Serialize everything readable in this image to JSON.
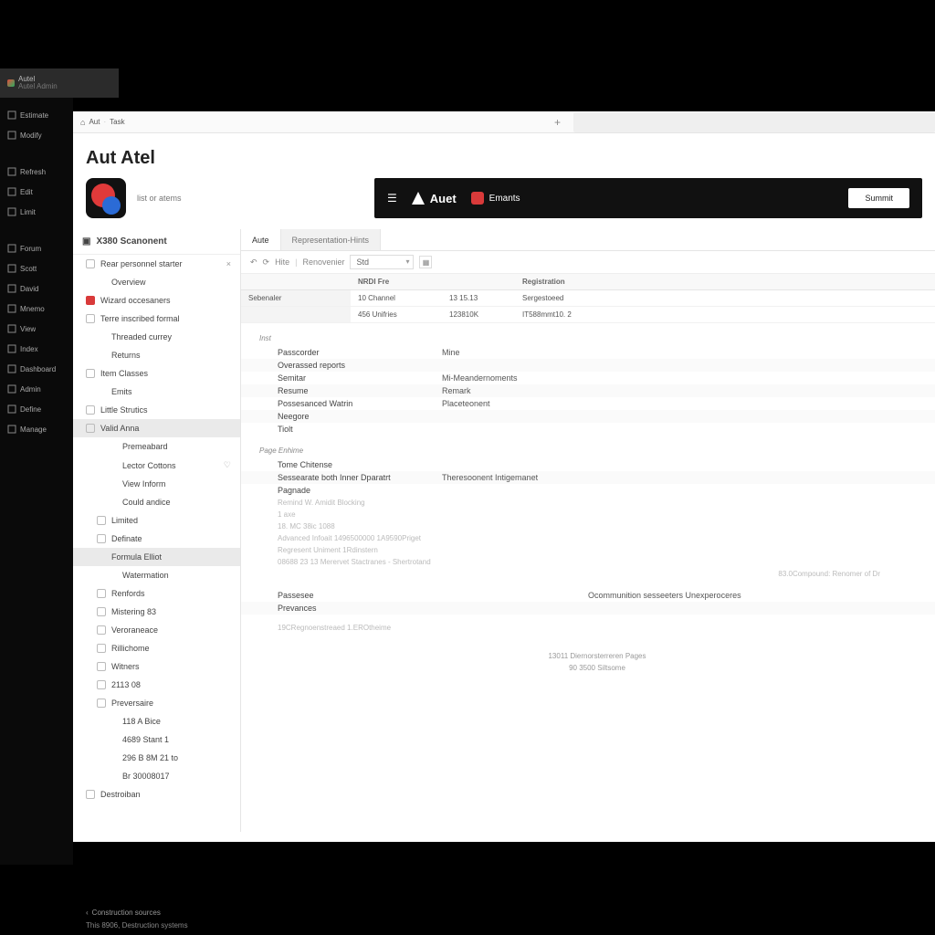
{
  "window_tab": {
    "title": "Autel",
    "subtitle": "Autel Admin"
  },
  "nav_rail": [
    "Estimate",
    "Modify",
    "",
    "Refresh",
    "Edit",
    "Limit",
    "",
    "Forum",
    "Scott",
    "David",
    "Mnemo",
    "View",
    "Index",
    "Dashboard",
    "Admin",
    "Define",
    "Manage"
  ],
  "breadcrumb": {
    "root": "Aut",
    "leaf": "Task"
  },
  "page_title": "Aut Atel",
  "brand_subtitle": "list or atems",
  "banner": {
    "brand": "Auet",
    "mid": "Emants",
    "button": "Summit"
  },
  "project_header": "X380 Scanonent",
  "project_tree": [
    {
      "label": "Rear personnel starter",
      "closable": true,
      "icon": "sq"
    },
    {
      "label": "Overview",
      "indent": 1
    },
    {
      "label": "Wizard occesaners",
      "icon": "red"
    },
    {
      "label": "Terre inscribed formal",
      "icon": "sq"
    },
    {
      "label": "Threaded currey",
      "indent": 1
    },
    {
      "label": "Returns",
      "indent": 1
    },
    {
      "label": "Item Classes",
      "icon": "sq"
    },
    {
      "label": "Emits",
      "indent": 1
    },
    {
      "label": "Little Strutics",
      "icon": "sq"
    },
    {
      "label": "Valid Anna",
      "icon": "sq",
      "active": true
    },
    {
      "label": "Premeabard",
      "indent": 2
    },
    {
      "label": "Lector Cottons",
      "indent": 2,
      "heart": true
    },
    {
      "label": "View Inform",
      "indent": 2
    },
    {
      "label": "Could andice",
      "indent": 2
    },
    {
      "label": "Limited",
      "icon": "sq",
      "indent": 1
    },
    {
      "label": "Definate",
      "icon": "sq",
      "indent": 1
    },
    {
      "label": "Formula Elliot",
      "indent": 1,
      "active": true
    },
    {
      "label": "Watermation",
      "indent": 2
    },
    {
      "label": "Renfords",
      "icon": "sq",
      "indent": 1
    },
    {
      "label": "Mistering 83",
      "icon": "sq",
      "indent": 1
    },
    {
      "label": "Veroraneace",
      "icon": "sq",
      "indent": 1
    },
    {
      "label": "Rillichome",
      "icon": "sq",
      "indent": 1
    },
    {
      "label": "Witners",
      "icon": "sq",
      "indent": 1
    },
    {
      "label": "2113 08",
      "icon": "sq",
      "indent": 1
    },
    {
      "label": "Preversaire",
      "icon": "sq",
      "indent": 1
    },
    {
      "label": "118 A Bice",
      "indent": 2
    },
    {
      "label": "4689 Stant 1",
      "indent": 2
    },
    {
      "label": "296 B 8M 21 to",
      "indent": 2
    },
    {
      "label": "Br 30008017",
      "indent": 2
    },
    {
      "label": "Destroiban",
      "icon": "sq"
    }
  ],
  "footer1": "Construction sources",
  "footer2": "This 8906, Destruction systems",
  "content_tabs": {
    "first": "Aute",
    "second": "Representation-Hints"
  },
  "toolbar": {
    "history": "Hite",
    "filter": "Renovenier",
    "select": "Std"
  },
  "grid_headers": [
    "",
    "NRDI Fre",
    "",
    "Registration"
  ],
  "grid_rows": [
    [
      "Sebenaler",
      "10 Channel",
      "13 15.13",
      "Sergestoeed"
    ],
    [
      "",
      "456 Unifries",
      "123810K",
      "IT588mmt10. 2"
    ]
  ],
  "detail_section": "Inst",
  "details": [
    {
      "k": "Passcorder",
      "v": "Mine"
    },
    {
      "k": "Overassed reports",
      "v": ""
    },
    {
      "k": "Semitar",
      "v": "Mi-Meandernoments"
    },
    {
      "k": "Resume",
      "v": "Remark"
    },
    {
      "k": "Possesanced Watrin",
      "v": "Placeteonent"
    },
    {
      "k": "Neegore",
      "v": ""
    },
    {
      "k": "Tiolt",
      "v": ""
    }
  ],
  "page_section": "Page Enhime",
  "page_rows": [
    "Tome Chitense",
    "Sessearate both Inner Dparatrt",
    "Pagnade"
  ],
  "page_kv": {
    "k": "Sessearate both Inner Dparatrt",
    "v": "Theresoonent Intigemanet"
  },
  "faded_lines": [
    "Remind W.    Amidit   Blocking",
    "1 axe",
    "18. MC  38ic  1088",
    "Advanced  Infoait  1496500000  1A9590Priget",
    "Regresent Uniment  1Rdinstern",
    "08688 23 13 Merervet  Stactranes - Shertrotand"
  ],
  "right_note": "83.0Compound:  Renomer of Dr",
  "bottom_block": [
    {
      "left": "Passesee",
      "right": "Ocommunition sesseeters Unexperoceres"
    },
    {
      "left": "Prevances",
      "right": ""
    }
  ],
  "bottom_faded": "19CRegnoenstreaed  1.EROtheime",
  "center_lines": [
    "13011 Diernorsterreren Pages",
    "90 3500 Siltsome"
  ]
}
